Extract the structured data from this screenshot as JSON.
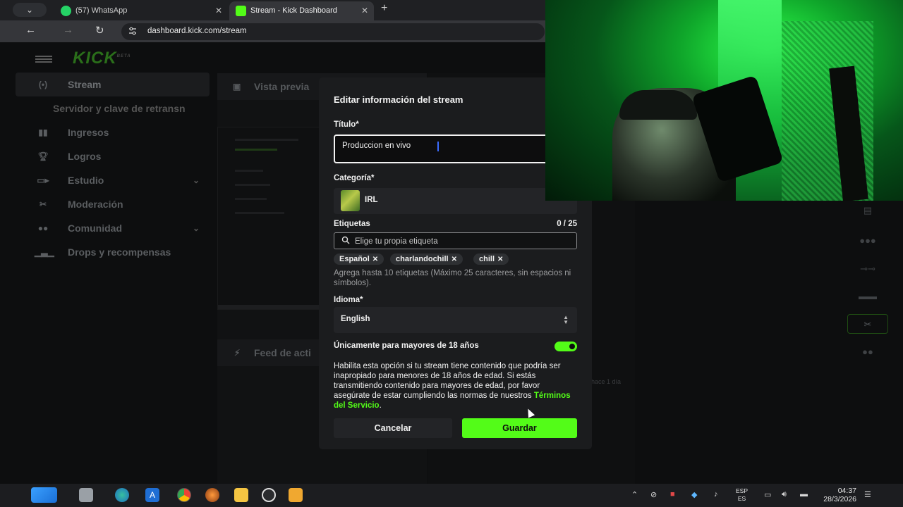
{
  "browser": {
    "tabs": [
      {
        "title": "(57) WhatsApp",
        "active": false
      },
      {
        "title": "Stream - Kick Dashboard",
        "active": true
      }
    ],
    "new_tab": "+",
    "url": "dashboard.kick.com/stream"
  },
  "dashboard": {
    "logo": "KICK",
    "logo_badge": "BETA",
    "sidebar": [
      {
        "label": "Stream",
        "icon": "broadcast-icon",
        "active": true
      },
      {
        "label": "Servidor y clave de retransn",
        "sub": true
      },
      {
        "label": "Ingresos",
        "icon": "chart-icon"
      },
      {
        "label": "Logros",
        "icon": "trophy-icon"
      },
      {
        "label": "Estudio",
        "icon": "studio-icon",
        "expandable": true
      },
      {
        "label": "Moderación",
        "icon": "wrench-icon"
      },
      {
        "label": "Comunidad",
        "icon": "community-icon",
        "expandable": true
      },
      {
        "label": "Drops y recompensas",
        "icon": "drops-icon"
      }
    ],
    "preview_title": "Vista previa",
    "feed_title": "Feed de acti",
    "feed_time": "hace 1 día"
  },
  "modal": {
    "title": "Editar información del stream",
    "title_label": "Título*",
    "title_value": "Produccion en vivo",
    "category_label": "Categoría*",
    "category_value": "IRL",
    "tags_label": "Etiquetas",
    "tags_count": "0 / 25",
    "tags_placeholder": "Elige tu propia etiqueta",
    "tags": [
      "Español",
      "charlandochill",
      "chill"
    ],
    "tags_hint": "Agrega hasta 10 etiquetas (Máximo 25 caracteres, sin espacios ni símbolos).",
    "language_label": "Idioma*",
    "language_value": "English",
    "adult_label": "Únicamente para mayores de 18 años",
    "adult_enabled": true,
    "adult_text": "Habilita esta opción si tu stream tiene contenido que podría ser inapropiado para menores de 18 años de edad. Si estás transmitiendo contenido para mayores de edad, por favor asegúrate de estar cumpliendo las normas de nuestros",
    "adult_link": "Términos del Servicio",
    "cancel": "Cancelar",
    "save": "Guardar"
  },
  "taskbar": {
    "lang_top": "ESP",
    "lang_bottom": "ES",
    "time": "04:37",
    "date": "28/3/2026"
  },
  "colors": {
    "kick_green": "#53fc18",
    "modal_bg": "#1b1c1e"
  }
}
